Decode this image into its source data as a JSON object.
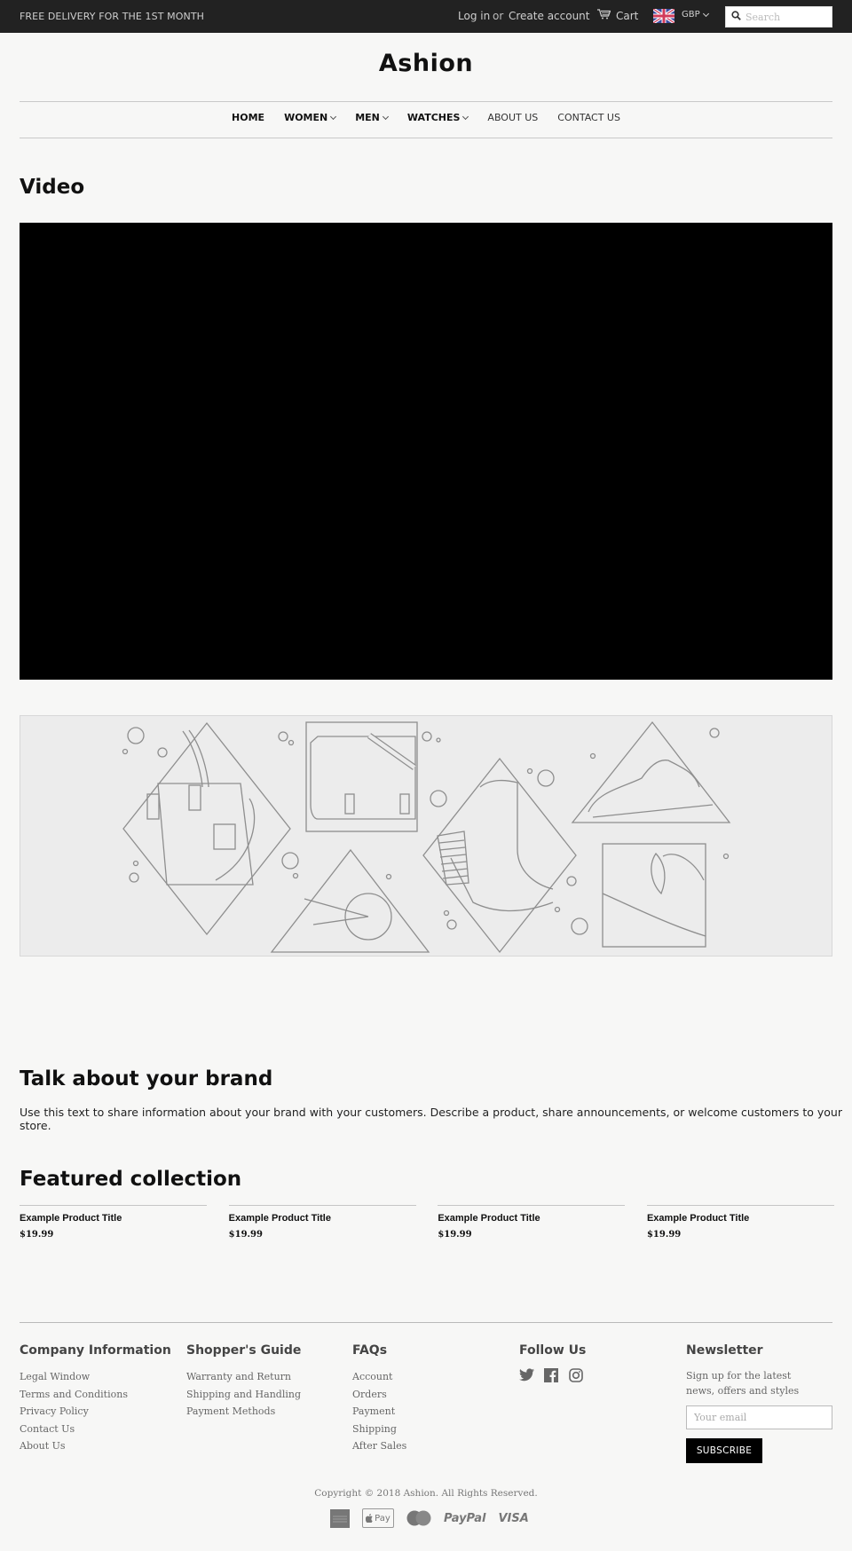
{
  "topbar": {
    "promo": "FREE DELIVERY FOR THE 1ST MONTH",
    "login": "Log in",
    "or": "or",
    "create_account": "Create account",
    "cart": "Cart",
    "currency": "GBP",
    "search_placeholder": "Search",
    "search_value": ""
  },
  "header": {
    "logo": "Ashion",
    "nav": [
      {
        "label": "HOME",
        "dropdown": false
      },
      {
        "label": "WOMEN",
        "dropdown": true
      },
      {
        "label": "MEN",
        "dropdown": true
      },
      {
        "label": "WATCHES",
        "dropdown": true
      },
      {
        "label": "ABOUT US",
        "dropdown": false
      },
      {
        "label": "CONTACT US",
        "dropdown": false
      }
    ]
  },
  "video_section": {
    "title": "Video"
  },
  "brand_section": {
    "title": "Talk about your brand",
    "text": "Use this text to share information about your brand with your customers. Describe a product, share announcements, or welcome customers to your store."
  },
  "featured": {
    "title": "Featured collection",
    "products": [
      {
        "title": "Example Product Title",
        "price": "$19.99"
      },
      {
        "title": "Example Product Title",
        "price": "$19.99"
      },
      {
        "title": "Example Product Title",
        "price": "$19.99"
      },
      {
        "title": "Example Product Title",
        "price": "$19.99"
      }
    ]
  },
  "footer": {
    "company": {
      "title": "Company Information",
      "links": [
        "Legal Window",
        "Terms and Conditions",
        "Privacy Policy",
        "Contact Us",
        "About Us"
      ]
    },
    "shopper": {
      "title": "Shopper's Guide",
      "links": [
        "Warranty and Return",
        "Shipping and Handling",
        "Payment Methods"
      ]
    },
    "faqs": {
      "title": "FAQs",
      "links": [
        "Account",
        "Orders",
        "Payment",
        "Shipping",
        "After Sales"
      ]
    },
    "follow": {
      "title": "Follow Us",
      "icons": [
        "twitter-icon",
        "facebook-icon",
        "instagram-icon"
      ]
    },
    "newsletter": {
      "title": "Newsletter",
      "text": "Sign up for the latest news, offers and styles",
      "placeholder": "Your email",
      "button": "SUBSCRIBE"
    },
    "copyright": "Copyright © 2018 Ashion. All Rights Reserved.",
    "payments": [
      "American Express",
      "Apple Pay",
      "MasterCard",
      "PayPal",
      "VISA"
    ],
    "payment_labels": {
      "applepay": "Pay",
      "paypal": "PayPal",
      "visa": "VISA"
    }
  }
}
